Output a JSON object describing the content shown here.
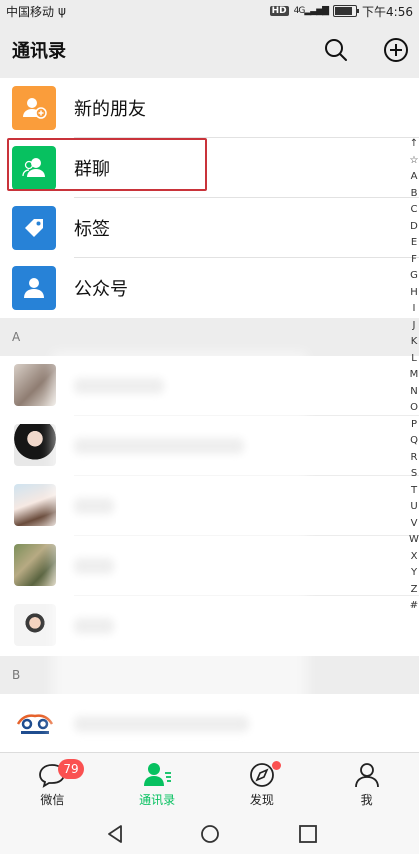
{
  "status_bar": {
    "carrier": "中国移动",
    "carrier_icon": "usb-debug-icon",
    "hd": "HD",
    "signal": "4G",
    "battery_level": 0.85,
    "time": "下午4:56"
  },
  "header": {
    "title": "通讯录",
    "search_icon": "search-icon",
    "add_icon": "plus-circle-icon"
  },
  "functions": [
    {
      "label": "新的朋友",
      "color": "#fa9d3b",
      "icon": "add-friend-icon"
    },
    {
      "label": "群聊",
      "color": "#07c160",
      "icon": "group-chat-icon"
    },
    {
      "label": "标签",
      "color": "#2782d7",
      "icon": "tag-icon"
    },
    {
      "label": "公众号",
      "color": "#2782d7",
      "icon": "official-account-icon"
    }
  ],
  "sections": [
    {
      "letter": "A"
    },
    {
      "letter": "B"
    }
  ],
  "contacts_a_count": 5,
  "index_letters": [
    "↑",
    "☆",
    "A",
    "B",
    "C",
    "D",
    "E",
    "F",
    "G",
    "H",
    "I",
    "J",
    "K",
    "L",
    "M",
    "N",
    "O",
    "P",
    "Q",
    "R",
    "S",
    "T",
    "U",
    "V",
    "W",
    "X",
    "Y",
    "Z",
    "#"
  ],
  "tabs": [
    {
      "label": "微信",
      "icon": "chat-bubble-icon",
      "badge": "79"
    },
    {
      "label": "通讯录",
      "icon": "contacts-icon",
      "active": true
    },
    {
      "label": "发现",
      "icon": "compass-icon",
      "dot": true
    },
    {
      "label": "我",
      "icon": "person-icon"
    }
  ],
  "colors": {
    "accent": "#07c160",
    "highlight": "#c9333a",
    "badge": "#fa5151"
  }
}
